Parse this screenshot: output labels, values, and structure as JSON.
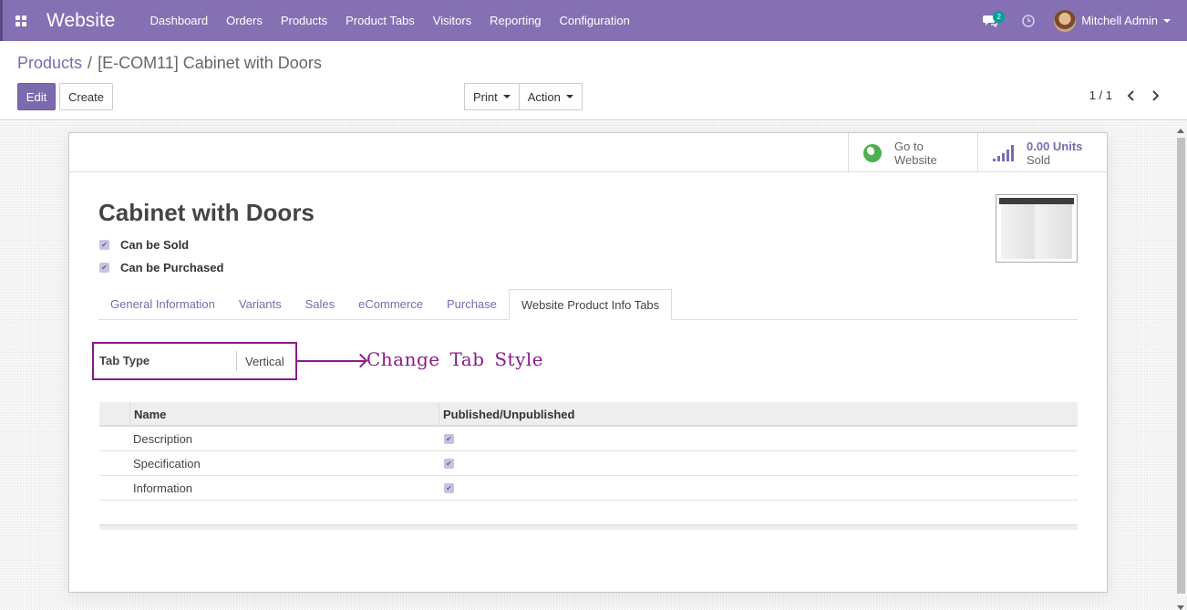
{
  "app": {
    "brand": "Website"
  },
  "menu": [
    "Dashboard",
    "Orders",
    "Products",
    "Product Tabs",
    "Visitors",
    "Reporting",
    "Configuration"
  ],
  "header": {
    "chat_count": "2",
    "user_name": "Mitchell Admin"
  },
  "breadcrumb": {
    "parent": "Products",
    "separator": "/",
    "current": "[E-COM11] Cabinet with Doors"
  },
  "toolbar": {
    "edit_label": "Edit",
    "create_label": "Create",
    "print_label": "Print",
    "action_label": "Action",
    "pager": "1 / 1"
  },
  "stats": {
    "website_line1": "Go to",
    "website_line2": "Website",
    "sold_value": "0.00 Units",
    "sold_label": "Sold"
  },
  "product": {
    "name": "Cabinet with Doors",
    "can_be_sold": "Can be Sold",
    "can_be_purchased": "Can be Purchased"
  },
  "tabs": [
    "General Information",
    "Variants",
    "Sales",
    "eCommerce",
    "Purchase",
    "Website Product Info Tabs"
  ],
  "tab_type": {
    "label": "Tab Type",
    "value": "Vertical"
  },
  "annotation": "Change Tab Style",
  "table": {
    "headers": {
      "name": "Name",
      "published": "Published/Unpublished"
    },
    "rows": [
      {
        "name": "Description",
        "published": true
      },
      {
        "name": "Specification",
        "published": true
      },
      {
        "name": "Information",
        "published": true
      }
    ]
  },
  "colors": {
    "navbar": "#8470b3",
    "accent": "#7c6aae",
    "annotation": "#8b1a8b"
  }
}
